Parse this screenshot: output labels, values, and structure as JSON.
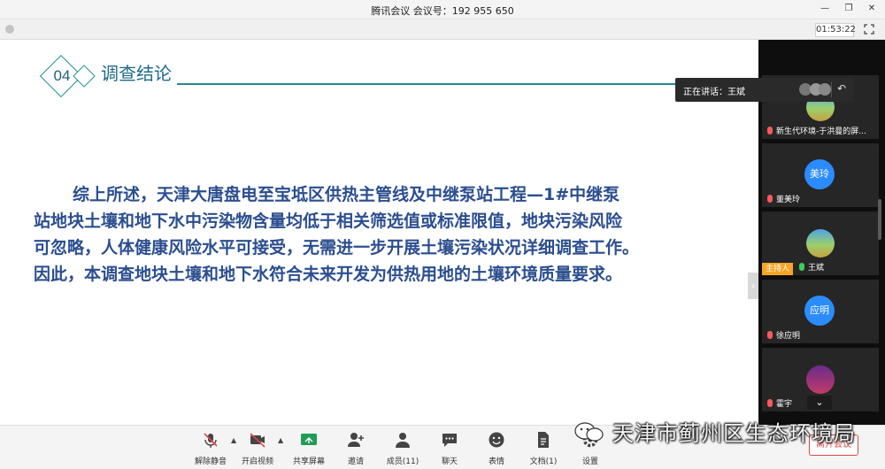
{
  "titlebar": {
    "title": "腾讯会议 会议号：192 955 650"
  },
  "infobar": {
    "timer": "01:53:22"
  },
  "slide": {
    "section_number": "04",
    "section_title": "调查结论",
    "paragraph": [
      "综上所述，天津大唐盘电至宝坻区供热主管线及中继泵站工程—1#中继泵",
      "站地块土壤和地下水中污染物含量均低于相关筛选值或标准限值，地块污染风险",
      "可忽略，人体健康风险水平可接受，无需进一步开展土壤污染状况详细调查工作。",
      "因此，本调查地块土壤和地下水符合未来开发为供热用地的土壤环境质量要求。"
    ],
    "accent_color": "#1f8c8a",
    "text_color": "#2b4e8f"
  },
  "speaking": {
    "label": "正在讲话：王斌"
  },
  "participants": [
    {
      "name": "新生代环境-于洪曼的屏...",
      "avatar": "",
      "mic": "muted"
    },
    {
      "name": "董美玲",
      "avatar": "美玲",
      "mic": "muted"
    },
    {
      "name": "王斌",
      "avatar": "",
      "mic": "on",
      "host_tag": "主持人"
    },
    {
      "name": "徐应明",
      "avatar": "应明",
      "mic": "muted"
    },
    {
      "name": "霍宇",
      "avatar": "",
      "mic": "muted"
    }
  ],
  "toolbar": {
    "unmute": "解除静音",
    "video": "开启视频",
    "share": "共享屏幕",
    "invite": "邀请",
    "members": "成员(11)",
    "chat": "聊天",
    "reactions": "表情",
    "docs": "文档(1)",
    "settings": "设置",
    "leave": "离开会议"
  },
  "watermark": "天津市蓟州区生态环境局"
}
